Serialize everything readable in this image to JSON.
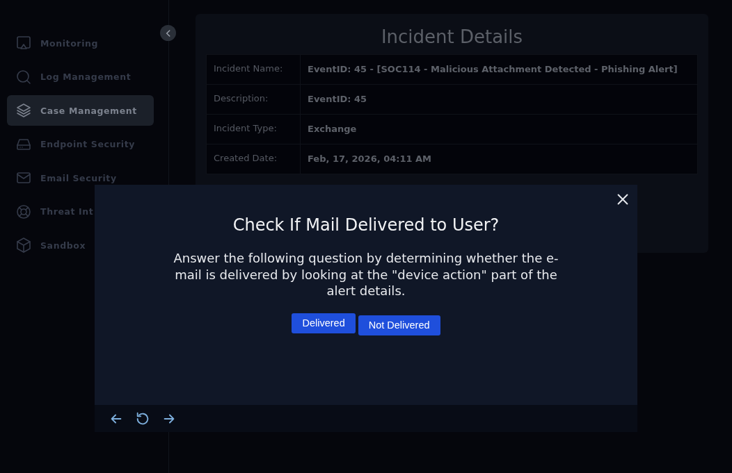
{
  "sidebar": {
    "items": [
      {
        "label": "Monitoring",
        "selected": false
      },
      {
        "label": "Log Management",
        "selected": false
      },
      {
        "label": "Case Management",
        "selected": true
      },
      {
        "label": "Endpoint Security",
        "selected": false
      },
      {
        "label": "Email Security",
        "selected": false
      },
      {
        "label": "Threat Int",
        "selected": false
      },
      {
        "label": "Sandbox",
        "selected": false
      }
    ]
  },
  "incident": {
    "title": "Incident Details",
    "rows": [
      {
        "label": "Incident Name:",
        "value": "EventID: 45 - [SOC114 - Malicious Attachment Detected - Phishing Alert]"
      },
      {
        "label": "Description:",
        "value": "EventID: 45"
      },
      {
        "label": "Incident Type:",
        "value": "Exchange"
      },
      {
        "label": "Created Date:",
        "value": "Feb, 17, 2026, 04:11 AM"
      }
    ]
  },
  "modal": {
    "title": "Check If Mail Delivered to User?",
    "question": "Answer the following question by determining whether the e-mail is delivered by looking at the \"device action\" part of the alert details.",
    "answers": [
      "Delivered",
      "Not Delivered"
    ]
  }
}
